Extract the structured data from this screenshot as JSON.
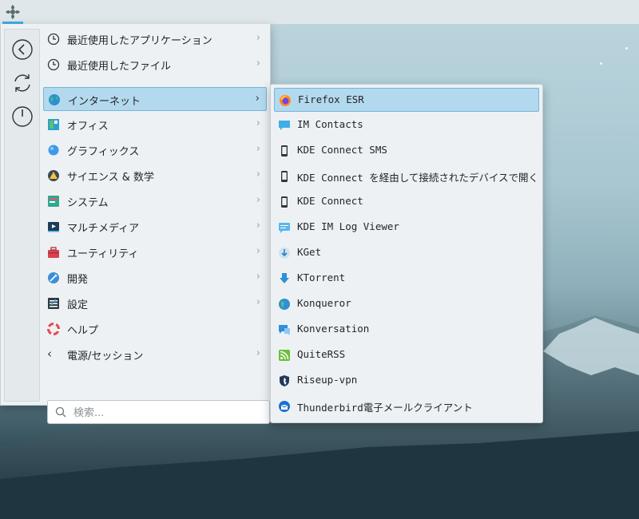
{
  "menu": {
    "categories": [
      {
        "label": "最近使用したアプリケーション",
        "icon": "clock-icon"
      },
      {
        "label": "最近使用したファイル",
        "icon": "clock-icon"
      },
      {
        "label": "インターネット",
        "icon": "globe-icon",
        "selected": true
      },
      {
        "label": "オフィス",
        "icon": "office-icon"
      },
      {
        "label": "グラフィックス",
        "icon": "graphics-icon"
      },
      {
        "label": "サイエンス & 数学",
        "icon": "science-icon"
      },
      {
        "label": "システム",
        "icon": "system-icon"
      },
      {
        "label": "マルチメディア",
        "icon": "multimedia-icon"
      },
      {
        "label": "ユーティリティ",
        "icon": "toolbox-icon"
      },
      {
        "label": "開発",
        "icon": "development-icon"
      },
      {
        "label": "設定",
        "icon": "settings-icon"
      },
      {
        "label": "ヘルプ",
        "icon": "lifebuoy-icon"
      },
      {
        "label": "電源/セッション",
        "icon": "chevron-left-icon"
      }
    ],
    "search_placeholder": "検索...",
    "sidebar_buttons": [
      "back-icon",
      "refresh-icon",
      "power-icon"
    ]
  },
  "submenu": {
    "apps": [
      {
        "label": "Firefox ESR",
        "icon": "firefox-icon",
        "selected": true
      },
      {
        "label": "IM Contacts",
        "icon": "chat-icon"
      },
      {
        "label": "KDE Connect SMS",
        "icon": "phone-icon"
      },
      {
        "label": "KDE Connect を経由して接続されたデバイスで開く",
        "icon": "phone-icon"
      },
      {
        "label": "KDE Connect",
        "icon": "phone-icon"
      },
      {
        "label": "KDE IM Log Viewer",
        "icon": "log-viewer-icon"
      },
      {
        "label": "KGet",
        "icon": "kget-icon"
      },
      {
        "label": "KTorrent",
        "icon": "ktorrent-icon"
      },
      {
        "label": "Konqueror",
        "icon": "konqueror-icon"
      },
      {
        "label": "Konversation",
        "icon": "konversation-icon"
      },
      {
        "label": "QuiteRSS",
        "icon": "rss-icon"
      },
      {
        "label": "Riseup-vpn",
        "icon": "vpn-shield-icon"
      },
      {
        "label": "Thunderbird電子メールクライアント",
        "icon": "thunderbird-icon"
      }
    ]
  },
  "colors": {
    "selection_bg": "#b3d9ee",
    "selection_border": "#71b6dc",
    "accent": "#3daee9",
    "menu_bg": "#eef1f3"
  }
}
